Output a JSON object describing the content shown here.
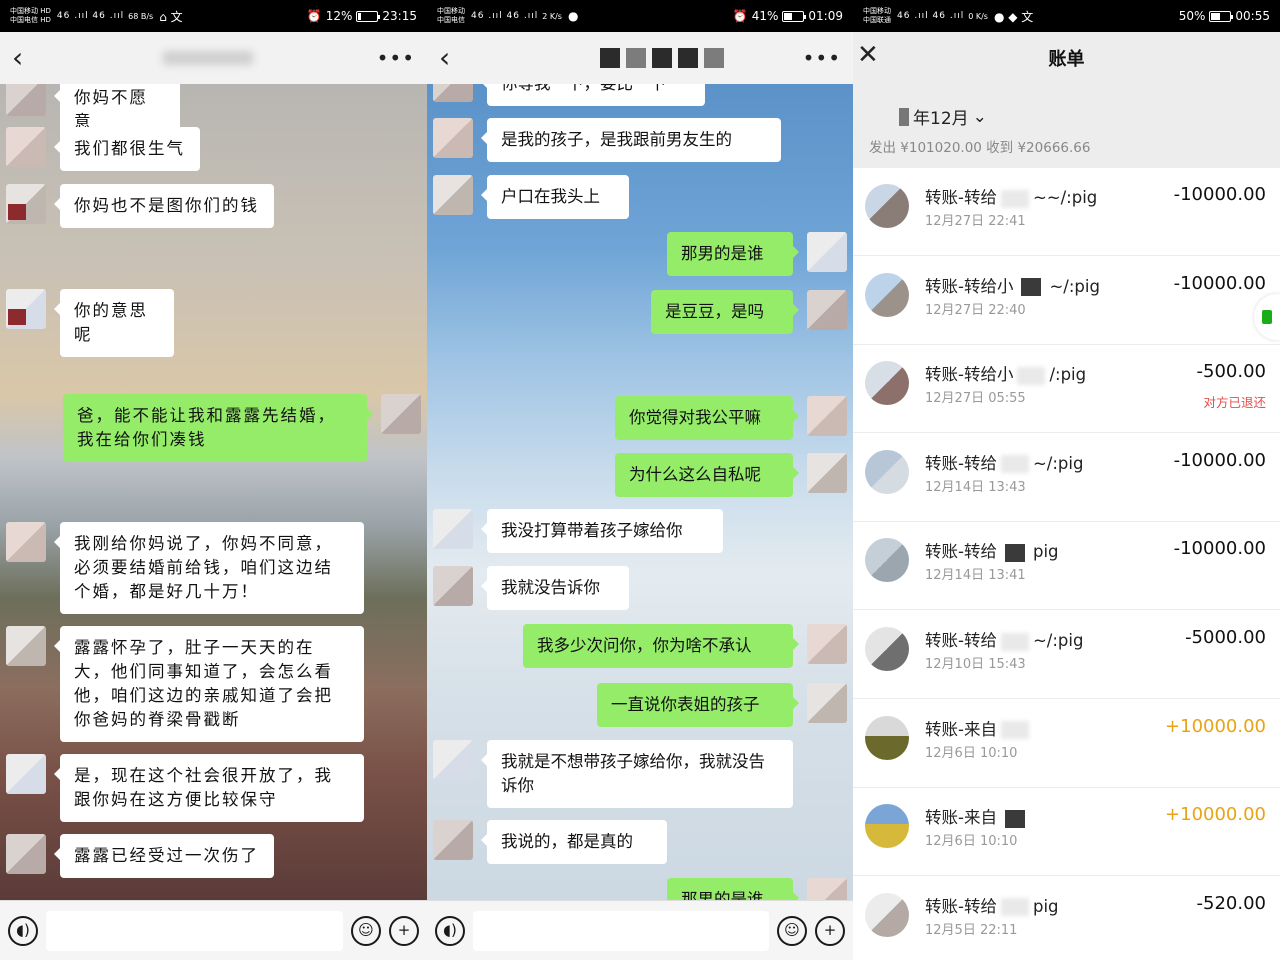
{
  "panel1": {
    "status": {
      "carrier1": "中国移动 HD",
      "carrier2": "中国电信 HD",
      "signal": "46 .ııl 46 .ııl",
      "speed": "68 B/s",
      "extra": "⌂ 文",
      "battery_pct": "12%",
      "time": "23:15",
      "battery_level": 0.12
    },
    "messages": [
      {
        "side": "left",
        "text": "你妈不愿意"
      },
      {
        "side": "left",
        "text": "我们都很生气"
      },
      {
        "side": "left",
        "text": "你妈也不是图你们的钱"
      },
      {
        "side": "left",
        "text": "你的意思呢"
      },
      {
        "side": "right",
        "text": "爸，能不能让我和露露先结婚，我在给你们凑钱"
      },
      {
        "side": "left",
        "text": "我刚给你妈说了，你妈不同意，必须要结婚前给钱，咱们这边结个婚，都是好几十万！"
      },
      {
        "side": "left",
        "text": "露露怀孕了，肚子一天天的在大，他们同事知道了，会怎么看他，咱们这边的亲戚知道了会把你爸妈的脊梁骨戳断"
      },
      {
        "side": "left",
        "text": "是，现在这个社会很开放了，我跟你妈在这方便比较保守"
      },
      {
        "side": "left",
        "text": "露露已经受过一次伤了"
      }
    ]
  },
  "panel2": {
    "status": {
      "carrier1": "中国移动",
      "carrier2": "中国电信",
      "signal": "46 .ııl 46 .ııl",
      "speed": "2 K/s",
      "extra": "●",
      "battery_pct": "41%",
      "time": "01:09",
      "battery_level": 0.41
    },
    "messages": [
      {
        "side": "left",
        "text": "你等我一下，要比一下"
      },
      {
        "side": "left",
        "text": "是我的孩子，是我跟前男友生的"
      },
      {
        "side": "left",
        "text": "户口在我头上"
      },
      {
        "side": "right",
        "text": "那男的是谁"
      },
      {
        "side": "right",
        "text": "是豆豆，是吗"
      },
      {
        "side": "right",
        "text": "你觉得对我公平嘛"
      },
      {
        "side": "right",
        "text": "为什么这么自私呢"
      },
      {
        "side": "left",
        "text": "我没打算带着孩子嫁给你"
      },
      {
        "side": "left",
        "text": "我就没告诉你"
      },
      {
        "side": "right",
        "text": "我多少次问你，你为啥不承认"
      },
      {
        "side": "right",
        "text": "一直说你表姐的孩子"
      },
      {
        "side": "left",
        "text": "我就是不想带孩子嫁给你，我就没告诉你"
      },
      {
        "side": "left",
        "text": "我说的，都是真的"
      },
      {
        "side": "right",
        "text": "那男的是谁"
      }
    ]
  },
  "panel3": {
    "status": {
      "carrier1": "中国移动",
      "carrier2": "中国联通",
      "signal": "46 .ııl 46 .ııl",
      "speed": "0 K/s",
      "extra": "● ◆ 文",
      "battery_pct": "50%",
      "time": "00:55",
      "battery_level": 0.5
    },
    "title": "账单",
    "month": "年12月",
    "totals": "发出 ¥101020.00 收到 ¥20666.66",
    "items": [
      {
        "label_a": "转账-转给",
        "label_b": "~~/:pig",
        "date": "12月27日 22:41",
        "amount": "-10000.00",
        "type": "expense",
        "note": ""
      },
      {
        "label_a": "转账-转给小",
        "label_b": "~/:pig",
        "date": "12月27日 22:40",
        "amount": "-10000.00",
        "type": "expense",
        "note": ""
      },
      {
        "label_a": "转账-转给小",
        "label_b": "/:pig",
        "date": "12月27日 05:55",
        "amount": "-500.00",
        "type": "expense",
        "note": "对方已退还"
      },
      {
        "label_a": "转账-转给",
        "label_b": "~/:pig",
        "date": "12月14日 13:43",
        "amount": "-10000.00",
        "type": "expense",
        "note": ""
      },
      {
        "label_a": "转账-转给",
        "label_b": "pig",
        "date": "12月14日 13:41",
        "amount": "-10000.00",
        "type": "expense",
        "note": ""
      },
      {
        "label_a": "转账-转给",
        "label_b": "~/:pig",
        "date": "12月10日 15:43",
        "amount": "-5000.00",
        "type": "expense",
        "note": ""
      },
      {
        "label_a": "转账-来自",
        "label_b": "",
        "date": "12月6日 10:10",
        "amount": "+10000.00",
        "type": "income",
        "note": ""
      },
      {
        "label_a": "转账-来自",
        "label_b": "",
        "date": "12月6日 10:10",
        "amount": "+10000.00",
        "type": "income",
        "note": ""
      },
      {
        "label_a": "转账-转给",
        "label_b": "pig",
        "date": "12月5日 22:11",
        "amount": "-520.00",
        "type": "expense",
        "note": ""
      }
    ]
  },
  "colors": {
    "green_bubble": "#95ec69",
    "income": "#e8a317",
    "note": "#e0504d"
  },
  "icons": {
    "back": "back-icon",
    "more": "more-icon",
    "close": "close-icon",
    "voice": "voice-icon",
    "emoji": "emoji-icon",
    "plus": "plus-icon",
    "chevron": "chevron-down-icon"
  }
}
